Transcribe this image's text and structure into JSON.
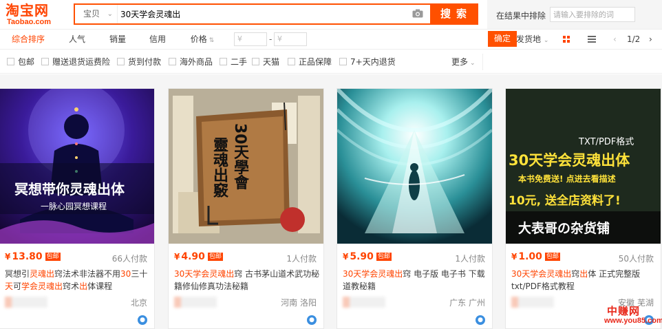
{
  "header": {
    "logo_cn": "淘宝网",
    "logo_en": "Taobao.com",
    "search_type": "宝贝",
    "search_value": "30天学会灵魂出",
    "search_button": "搜索",
    "exclude_label": "在结果中排除",
    "exclude_placeholder": "请输入要排除的词",
    "confirm_button": "确定"
  },
  "sortbar": {
    "items": [
      "综合排序",
      "人气",
      "销量",
      "信用",
      "价格"
    ],
    "price_min_placeholder": "¥",
    "price_max_placeholder": "¥",
    "price_dash": "-",
    "ship_from": "发货地",
    "pager": {
      "prev": "‹",
      "current": "1/2",
      "next": "›"
    }
  },
  "filters": {
    "items": [
      "包邮",
      "赠送退货运费险",
      "货到付款",
      "海外商品",
      "二手",
      "天猫",
      "正品保障",
      "7+天内退货"
    ],
    "more": "更多"
  },
  "products": [
    {
      "price": "13.80",
      "currency": "¥",
      "badge": "包邮",
      "sales": "66人付款",
      "title_parts": [
        {
          "t": "冥想引",
          "h": false
        },
        {
          "t": "灵魂出",
          "h": true
        },
        {
          "t": "窍法术非法器不用",
          "h": false
        },
        {
          "t": "30",
          "h": true
        },
        {
          "t": "三十",
          "h": false
        },
        {
          "t": "天",
          "h": true
        },
        {
          "t": "可",
          "h": false
        },
        {
          "t": "学会灵魂出",
          "h": true
        },
        {
          "t": "窍术",
          "h": false
        },
        {
          "t": "出",
          "h": true
        },
        {
          "t": "体课程",
          "h": false
        }
      ],
      "location": "北京",
      "image_text_1": "冥想带你灵魂出体",
      "image_text_2": "一脉心园冥想课程"
    },
    {
      "price": "4.90",
      "currency": "¥",
      "badge": "包邮",
      "sales": "1人付款",
      "title_parts": [
        {
          "t": "30天学会灵魂出",
          "h": true
        },
        {
          "t": "窍 古书茅山道术武功秘籍修仙修真功法秘籍",
          "h": false
        }
      ],
      "location": "河南 洛阳",
      "image_text_1": "30天學會",
      "image_text_2": "靈魂出竅"
    },
    {
      "price": "5.90",
      "currency": "¥",
      "badge": "包邮",
      "sales": "1人付款",
      "title_parts": [
        {
          "t": "30天学会灵魂出",
          "h": true
        },
        {
          "t": "窍 电子版 电子书 下载 道教秘籍",
          "h": false
        }
      ],
      "location": "广东 广州"
    },
    {
      "price": "1.00",
      "currency": "¥",
      "badge": "包邮",
      "sales": "50人付款",
      "title_parts": [
        {
          "t": "30天学会灵魂出",
          "h": true
        },
        {
          "t": "窍",
          "h": false
        },
        {
          "t": "出",
          "h": true
        },
        {
          "t": "体 正式完整版 txt/PDF格式教程",
          "h": false
        }
      ],
      "location": "安徽 芜湖",
      "image_text_1": "TXT/PDF格式",
      "image_text_2": "30天学会灵魂出体",
      "image_text_3": "本书免费送! 点进去看描述",
      "image_text_4": "10元, 送全店资料了!",
      "image_text_5": "大表哥の杂货铺"
    }
  ],
  "watermark": {
    "cn": "中赚网",
    "url": "www.you85.com"
  },
  "colors": {
    "accent": "#ff5000",
    "price": "#ff4400"
  }
}
